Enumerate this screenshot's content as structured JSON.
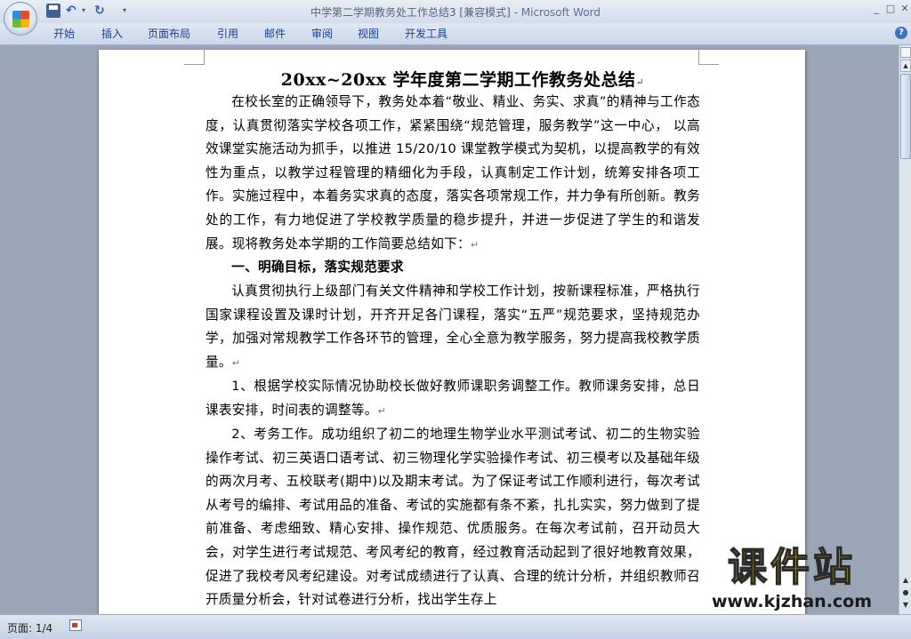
{
  "window": {
    "title": "中学第二学期教务处工作总结3 [兼容模式]",
    "title_sep": " - ",
    "app_name": "Microsoft Word"
  },
  "quick_access": {
    "undo_glyph": "↶",
    "redo_glyph": "↻",
    "dropdown_glyph": "▾",
    "customize_glyph": "▾"
  },
  "window_controls": {
    "minimize": "_",
    "maximize": "□",
    "close": "✕"
  },
  "ribbon": {
    "tabs": [
      "开始",
      "插入",
      "页面布局",
      "引用",
      "邮件",
      "审阅",
      "视图",
      "开发工具"
    ],
    "help": "?"
  },
  "document": {
    "title": "20xx~20xx 学年度第二学期工作教务处总结",
    "paragraphs": [
      "在校长室的正确领导下，教务处本着“敬业、精业、务实、求真”的精神与工作态度，认真贯彻落实学校各项工作，紧紧围绕“规范管理，服务教学”这一中心， 以高效课堂实施活动为抓手，以推进 15/20/10 课堂教学模式为契机，以提高教学的有效性为重点，以教学过程管理的精细化为手段，认真制定工作计划，统筹安排各项工作。实施过程中，本着务实求真的态度，落实各项常规工作，并力争有所创新。教务处的工作，有力地促进了学校教学质量的稳步提升，并进一步促进了学生的和谐发展。现将教务处本学期的工作简要总结如下：",
      "一、明确目标，落实规范要求",
      "认真贯彻执行上级部门有关文件精神和学校工作计划，按新课程标准，严格执行国家课程设置及课时计划，开齐开足各门课程，落实“五严”规范要求，坚持规范办学，加强对常规教学工作各环节的管理，全心全意为教学服务，努力提高我校教学质量。",
      "1、根据学校实际情况协助校长做好教师课职务调整工作。教师课务安排，总日课表安排，时间表的调整等。",
      "2、考务工作。成功组织了初二的地理生物学业水平测试考试、初二的生物实验操作考试、初三英语口语考试、初三物理化学实验操作考试、初三模考以及基础年级的两次月考、五校联考(期中)以及期末考试。为了保证考试工作顺利进行，每次考试从考号的编排、考试用品的准备、考试的实施都有条不紊，扎扎实实，努力做到了提前准备、考虑细致、精心安排、操作规范、优质服务。在每次考试前，召开动员大会，对学生进行考试规范、考风考纪的教育，经过教育活动起到了很好地教育效果，促进了我校考风考纪建设。对考试成绩进行了认真、合理的统计分析，并组织教师召开质量分析会，针对试卷进行分析，找出学生存上"
    ],
    "paragraph_mark": "↵"
  },
  "statusbar": {
    "page": "页面: 1/4"
  },
  "watermark": {
    "text": "课件站",
    "url": "www.kjzhan.com"
  },
  "colors": {
    "ribbon_text": "#15428b",
    "doc_background": "#9aa6b6",
    "watermark_yellow": "#f6d20e"
  }
}
